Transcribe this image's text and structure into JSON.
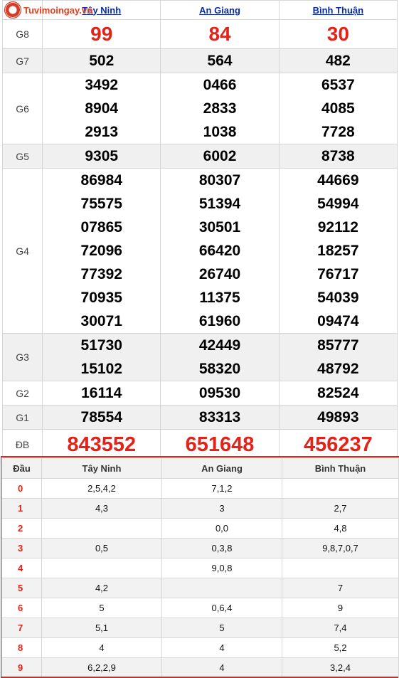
{
  "logo": {
    "text": "Tuvimoingay.vn"
  },
  "provinces": [
    "Tây Ninh",
    "An Giang",
    "Bình Thuận"
  ],
  "prizes": [
    {
      "label": "G8",
      "style": "g8",
      "values": [
        [
          "99"
        ],
        [
          "84"
        ],
        [
          "30"
        ]
      ]
    },
    {
      "label": "G7",
      "style": "normal",
      "values": [
        [
          "502"
        ],
        [
          "564"
        ],
        [
          "482"
        ]
      ]
    },
    {
      "label": "G6",
      "style": "normal",
      "values": [
        [
          "3492",
          "8904",
          "2913"
        ],
        [
          "0466",
          "2833",
          "1038"
        ],
        [
          "6537",
          "4085",
          "7728"
        ]
      ]
    },
    {
      "label": "G5",
      "style": "normal",
      "values": [
        [
          "9305"
        ],
        [
          "6002"
        ],
        [
          "8738"
        ]
      ]
    },
    {
      "label": "G4",
      "style": "normal",
      "values": [
        [
          "86984",
          "75575",
          "07865",
          "72096",
          "77392",
          "70935",
          "30071"
        ],
        [
          "80307",
          "51394",
          "30501",
          "66420",
          "26740",
          "11375",
          "61960"
        ],
        [
          "44669",
          "54994",
          "92112",
          "18257",
          "76717",
          "54039",
          "09474"
        ]
      ]
    },
    {
      "label": "G3",
      "style": "normal",
      "values": [
        [
          "51730",
          "15102"
        ],
        [
          "42449",
          "58320"
        ],
        [
          "85777",
          "48792"
        ]
      ]
    },
    {
      "label": "G2",
      "style": "normal",
      "values": [
        [
          "16114"
        ],
        [
          "09530"
        ],
        [
          "82524"
        ]
      ]
    },
    {
      "label": "G1",
      "style": "normal",
      "values": [
        [
          "78554"
        ],
        [
          "83313"
        ],
        [
          "49893"
        ]
      ]
    },
    {
      "label": "ĐB",
      "style": "db",
      "values": [
        [
          "843552"
        ],
        [
          "651648"
        ],
        [
          "456237"
        ]
      ]
    }
  ],
  "dau_table": {
    "header": [
      "Đầu",
      "Tây Ninh",
      "An Giang",
      "Bình Thuận"
    ],
    "rows": [
      [
        "0",
        "2,5,4,2",
        "7,1,2",
        ""
      ],
      [
        "1",
        "4,3",
        "3",
        "2,7"
      ],
      [
        "2",
        "",
        "0,0",
        "4,8"
      ],
      [
        "3",
        "0,5",
        "0,3,8",
        "9,8,7,0,7"
      ],
      [
        "4",
        "",
        "9,0,8",
        ""
      ],
      [
        "5",
        "4,2",
        "",
        "7"
      ],
      [
        "6",
        "5",
        "0,6,4",
        "9"
      ],
      [
        "7",
        "5,1",
        "5",
        "7,4"
      ],
      [
        "8",
        "4",
        "4",
        "5,2"
      ],
      [
        "9",
        "6,2,2,9",
        "4",
        "3,2,4"
      ]
    ]
  }
}
